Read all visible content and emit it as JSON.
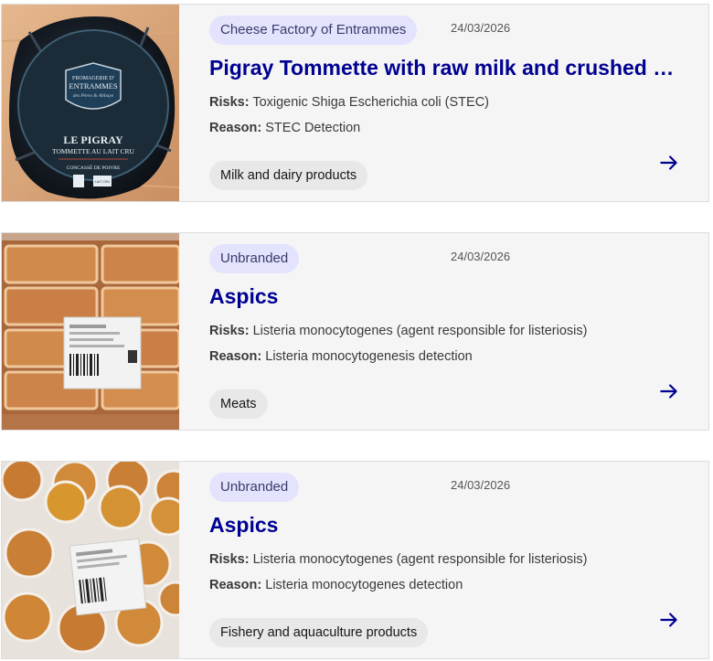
{
  "recalls": [
    {
      "brand": "Cheese Factory of Entrammes",
      "date": "24/03/2026",
      "title": "Pigray Tommette with raw milk and crushed pepper",
      "risks_label": "Risks:",
      "risks": "Toxigenic Shiga Escherichia coli (STEC)",
      "reason_label": "Reason:",
      "reason": "STEC Detection",
      "category": "Milk and dairy products",
      "image_label": {
        "l1": "FROMAGERIE D'",
        "l2": "ENTRAMMES",
        "l3": "des Pères & Abbaye",
        "name": "LE PIGRAY",
        "sub": "TOMMETTE AU LAIT CRU",
        "pepper": "CONCASSÉ DE POIVRE",
        "lait": "LAIT CRU"
      }
    },
    {
      "brand": "Unbranded",
      "date": "24/03/2026",
      "title": "Aspics",
      "risks_label": "Risks:",
      "risks": "Listeria monocytogenes (agent responsible for listeriosis)",
      "reason_label": "Reason:",
      "reason": "Listeria monocytogenesis detection",
      "category": "Meats"
    },
    {
      "brand": "Unbranded",
      "date": "24/03/2026",
      "title": "Aspics",
      "risks_label": "Risks:",
      "risks": "Listeria monocytogenes (agent responsible for listeriosis)",
      "reason_label": "Reason:",
      "reason": "Listeria monocytogenes detection",
      "category": "Fishery and aquaculture products"
    }
  ],
  "icons": {
    "arrow": "arrow-right-icon"
  },
  "colors": {
    "title": "#000091",
    "brand_bg": "#e3e3fd",
    "tag_bg": "#e8e8e8",
    "card_bg": "#f5f5f5"
  }
}
